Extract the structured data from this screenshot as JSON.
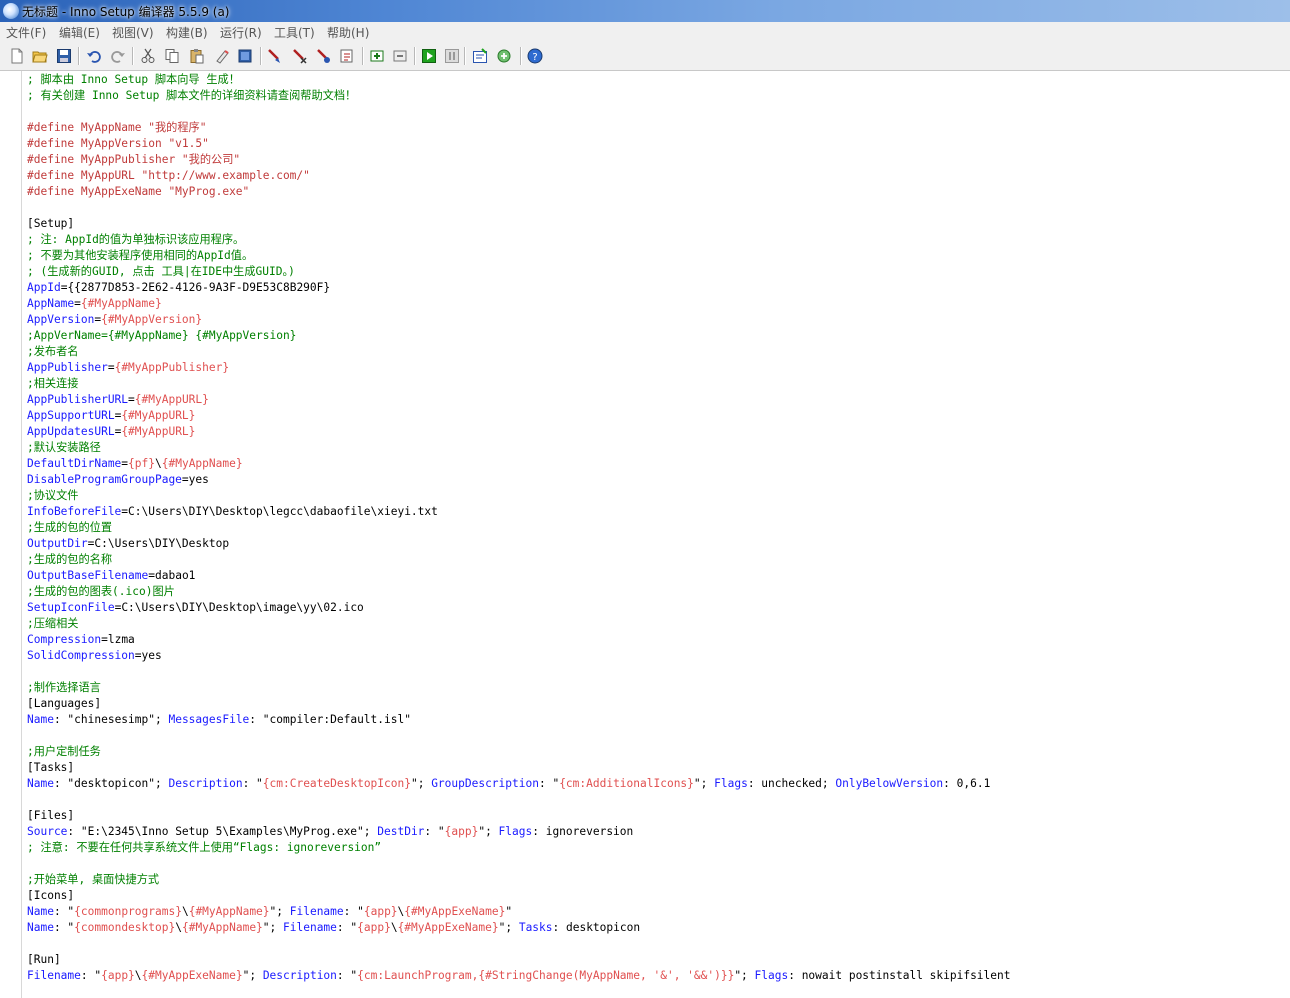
{
  "window": {
    "title": "无标题 - Inno Setup 编译器 5.5.9 (a)"
  },
  "menu": [
    {
      "label": "文件(F)"
    },
    {
      "label": "编辑(E)"
    },
    {
      "label": "视图(V)"
    },
    {
      "label": "构建(B)"
    },
    {
      "label": "运行(R)"
    },
    {
      "label": "工具(T)"
    },
    {
      "label": "帮助(H)"
    }
  ],
  "toolbar": [
    "new-file-icon",
    "open-folder-icon",
    "save-icon",
    "undo-icon",
    "redo-icon",
    "cut-icon",
    "copy-icon",
    "paste-icon",
    "clear-icon",
    "select-all-icon",
    "compile-icon",
    "stop-compile-icon",
    "toggle-breakpoint-icon",
    "step-into-icon",
    "target-setup-icon",
    "target-uninstall-icon",
    "run-icon",
    "pause-icon",
    "wizard-icon",
    "iss-tools-icon",
    "help-icon"
  ],
  "editor": {
    "lines": [
      {
        "t": "c",
        "v": "; 脚本由 Inno Setup 脚本向导 生成！"
      },
      {
        "t": "c",
        "v": "; 有关创建 Inno Setup 脚本文件的详细资料请查阅帮助文档！"
      },
      {
        "t": "blank",
        "v": ""
      },
      {
        "t": "d",
        "v": "#define MyAppName \"我的程序\""
      },
      {
        "t": "d",
        "v": "#define MyAppVersion \"v1.5\""
      },
      {
        "t": "d",
        "v": "#define MyAppPublisher \"我的公司\""
      },
      {
        "t": "d",
        "v": "#define MyAppURL \"http://www.example.com/\""
      },
      {
        "t": "d",
        "v": "#define MyAppExeName \"MyProg.exe\""
      },
      {
        "t": "blank",
        "v": ""
      },
      {
        "t": "s",
        "v": "[Setup]"
      },
      {
        "t": "c",
        "v": "; 注: AppId的值为单独标识该应用程序。"
      },
      {
        "t": "c",
        "v": "; 不要为其他安装程序使用相同的AppId值。"
      },
      {
        "t": "c",
        "v": "; (生成新的GUID, 点击 工具|在IDE中生成GUID。)"
      },
      {
        "t": "kv",
        "k": "AppId",
        "v": "{{2877D853-2E62-4126-9A3F-D9E53C8B290F}",
        "vc": "p"
      },
      {
        "t": "kv",
        "k": "AppName",
        "v": "{#MyAppName}",
        "vc": "v"
      },
      {
        "t": "kv",
        "k": "AppVersion",
        "v": "{#MyAppVersion}",
        "vc": "v"
      },
      {
        "t": "c",
        "v": ";AppVerName={#MyAppName} {#MyAppVersion}"
      },
      {
        "t": "c",
        "v": ";发布者名"
      },
      {
        "t": "kv",
        "k": "AppPublisher",
        "v": "{#MyAppPublisher}",
        "vc": "v"
      },
      {
        "t": "c",
        "v": ";相关连接"
      },
      {
        "t": "kv",
        "k": "AppPublisherURL",
        "v": "{#MyAppURL}",
        "vc": "v"
      },
      {
        "t": "kv",
        "k": "AppSupportURL",
        "v": "{#MyAppURL}",
        "vc": "v"
      },
      {
        "t": "kv",
        "k": "AppUpdatesURL",
        "v": "{#MyAppURL}",
        "vc": "v"
      },
      {
        "t": "c",
        "v": ";默认安装路径"
      },
      {
        "t": "kv2",
        "k": "DefaultDirName",
        "a": "{pf}",
        "b": "\\",
        "c": "{#MyAppName}"
      },
      {
        "t": "kv",
        "k": "DisableProgramGroupPage",
        "v": "yes",
        "vc": "p"
      },
      {
        "t": "c",
        "v": ";协议文件"
      },
      {
        "t": "kv",
        "k": "InfoBeforeFile",
        "v": "C:\\Users\\DIY\\Desktop\\legcc\\dabaofile\\xieyi.txt",
        "vc": "p"
      },
      {
        "t": "c",
        "v": ";生成的包的位置"
      },
      {
        "t": "kv",
        "k": "OutputDir",
        "v": "C:\\Users\\DIY\\Desktop",
        "vc": "p"
      },
      {
        "t": "c",
        "v": ";生成的包的名称"
      },
      {
        "t": "kv",
        "k": "OutputBaseFilename",
        "v": "dabao1",
        "vc": "p"
      },
      {
        "t": "c",
        "v": ";生成的包的图表(.ico)图片"
      },
      {
        "t": "kv",
        "k": "SetupIconFile",
        "v": "C:\\Users\\DIY\\Desktop\\image\\yy\\02.ico",
        "vc": "p"
      },
      {
        "t": "c",
        "v": ";压缩相关"
      },
      {
        "t": "kv",
        "k": "Compression",
        "v": "lzma",
        "vc": "p"
      },
      {
        "t": "kv",
        "k": "SolidCompression",
        "v": "yes",
        "vc": "p"
      },
      {
        "t": "blank",
        "v": ""
      },
      {
        "t": "c",
        "v": ";制作选择语言"
      },
      {
        "t": "s",
        "v": "[Languages]"
      },
      {
        "t": "raw",
        "segs": [
          [
            "k",
            "Name"
          ],
          [
            "p",
            ": \"chinesesimp\"; "
          ],
          [
            "k",
            "MessagesFile"
          ],
          [
            "p",
            ": \"compiler:Default.isl\""
          ]
        ]
      },
      {
        "t": "blank",
        "v": ""
      },
      {
        "t": "c",
        "v": ";用户定制任务"
      },
      {
        "t": "s",
        "v": "[Tasks]"
      },
      {
        "t": "raw",
        "segs": [
          [
            "k",
            "Name"
          ],
          [
            "p",
            ": \"desktopicon\"; "
          ],
          [
            "k",
            "Description"
          ],
          [
            "p",
            ": \""
          ],
          [
            "v",
            "{cm:CreateDesktopIcon}"
          ],
          [
            "p",
            "\"; "
          ],
          [
            "k",
            "GroupDescription"
          ],
          [
            "p",
            ": \""
          ],
          [
            "v",
            "{cm:AdditionalIcons}"
          ],
          [
            "p",
            "\"; "
          ],
          [
            "k",
            "Flags"
          ],
          [
            "p",
            ": unchecked; "
          ],
          [
            "k",
            "OnlyBelowVersion"
          ],
          [
            "p",
            ": 0,6.1"
          ]
        ]
      },
      {
        "t": "blank",
        "v": ""
      },
      {
        "t": "s",
        "v": "[Files]"
      },
      {
        "t": "raw",
        "segs": [
          [
            "k",
            "Source"
          ],
          [
            "p",
            ": \"E:\\2345\\Inno Setup 5\\Examples\\MyProg.exe\"; "
          ],
          [
            "k",
            "DestDir"
          ],
          [
            "p",
            ": \""
          ],
          [
            "v",
            "{app}"
          ],
          [
            "p",
            "\"; "
          ],
          [
            "k",
            "Flags"
          ],
          [
            "p",
            ": ignoreversion"
          ]
        ]
      },
      {
        "t": "c",
        "v": "; 注意: 不要在任何共享系统文件上使用“Flags: ignoreversion”"
      },
      {
        "t": "blank",
        "v": ""
      },
      {
        "t": "c",
        "v": ";开始菜单, 桌面快捷方式"
      },
      {
        "t": "s",
        "v": "[Icons]"
      },
      {
        "t": "raw",
        "segs": [
          [
            "k",
            "Name"
          ],
          [
            "p",
            ": \""
          ],
          [
            "v",
            "{commonprograms}"
          ],
          [
            "p",
            "\\"
          ],
          [
            "v",
            "{#MyAppName}"
          ],
          [
            "p",
            "\"; "
          ],
          [
            "k",
            "Filename"
          ],
          [
            "p",
            ": \""
          ],
          [
            "v",
            "{app}"
          ],
          [
            "p",
            "\\"
          ],
          [
            "v",
            "{#MyAppExeName}"
          ],
          [
            "p",
            "\""
          ]
        ]
      },
      {
        "t": "raw",
        "segs": [
          [
            "k",
            "Name"
          ],
          [
            "p",
            ": \""
          ],
          [
            "v",
            "{commondesktop}"
          ],
          [
            "p",
            "\\"
          ],
          [
            "v",
            "{#MyAppName}"
          ],
          [
            "p",
            "\"; "
          ],
          [
            "k",
            "Filename"
          ],
          [
            "p",
            ": \""
          ],
          [
            "v",
            "{app}"
          ],
          [
            "p",
            "\\"
          ],
          [
            "v",
            "{#MyAppExeName}"
          ],
          [
            "p",
            "\"; "
          ],
          [
            "k",
            "Tasks"
          ],
          [
            "p",
            ": desktopicon"
          ]
        ]
      },
      {
        "t": "blank",
        "v": ""
      },
      {
        "t": "s",
        "v": "[Run]"
      },
      {
        "t": "raw",
        "segs": [
          [
            "k",
            "Filename"
          ],
          [
            "p",
            ": \""
          ],
          [
            "v",
            "{app}"
          ],
          [
            "p",
            "\\"
          ],
          [
            "v",
            "{#MyAppExeName}"
          ],
          [
            "p",
            "\"; "
          ],
          [
            "k",
            "Description"
          ],
          [
            "p",
            ": \""
          ],
          [
            "v",
            "{cm:LaunchProgram,{#StringChange(MyAppName, '&', '&&')}}"
          ],
          [
            "p",
            "\"; "
          ],
          [
            "k",
            "Flags"
          ],
          [
            "p",
            ": nowait postinstall skipifsilent"
          ]
        ]
      }
    ]
  }
}
